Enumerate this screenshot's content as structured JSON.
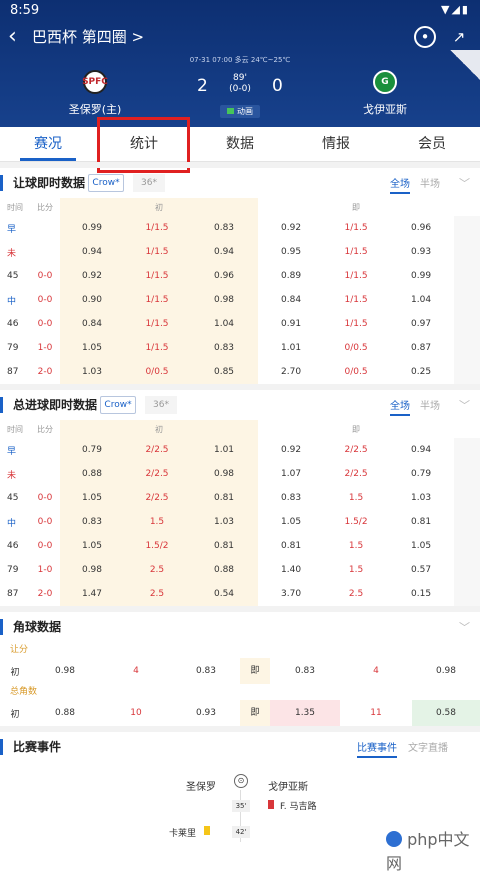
{
  "status": {
    "time": "8:59"
  },
  "nav": {
    "title": "巴西杯 第四圈 >"
  },
  "match": {
    "info": "07-31 07:00  多云 24℃~25℃",
    "home": {
      "name": "圣保罗(主)",
      "logo": "SPFC",
      "score": "2"
    },
    "away": {
      "name": "戈伊亚斯",
      "logo": "G",
      "score": "0"
    },
    "minute": "89'",
    "halftime": "(0-0)",
    "anim_label": "动画"
  },
  "tabs": [
    "赛况",
    "统计",
    "数据",
    "情报",
    "会员"
  ],
  "handicap": {
    "title": "让球即时数据",
    "crow": "Crow*",
    "alt": "36*",
    "seg_on": "全场",
    "seg_off": "半场",
    "header": [
      "时间",
      "比分",
      "初",
      "即"
    ],
    "rows": [
      [
        "早",
        "",
        "0.99",
        "1/1.5",
        "0.83",
        "0.92",
        "1/1.5",
        "0.96"
      ],
      [
        "未",
        "",
        "0.94",
        "1/1.5",
        "0.94",
        "0.95",
        "1/1.5",
        "0.93"
      ],
      [
        "45",
        "0-0",
        "0.92",
        "1/1.5",
        "0.96",
        "0.89",
        "1/1.5",
        "0.99"
      ],
      [
        "中",
        "0-0",
        "0.90",
        "1/1.5",
        "0.98",
        "0.84",
        "1/1.5",
        "1.04"
      ],
      [
        "46",
        "0-0",
        "0.84",
        "1/1.5",
        "1.04",
        "0.91",
        "1/1.5",
        "0.97"
      ],
      [
        "79",
        "1-0",
        "1.05",
        "1/1.5",
        "0.83",
        "1.01",
        "0/0.5",
        "0.87"
      ],
      [
        "87",
        "2-0",
        "1.03",
        "0/0.5",
        "0.85",
        "2.70",
        "0/0.5",
        "0.25"
      ]
    ]
  },
  "totals": {
    "title": "总进球即时数据",
    "crow": "Crow*",
    "alt": "36*",
    "seg_on": "全场",
    "seg_off": "半场",
    "header": [
      "时间",
      "比分",
      "初",
      "即"
    ],
    "rows": [
      [
        "早",
        "",
        "0.79",
        "2/2.5",
        "1.01",
        "0.92",
        "2/2.5",
        "0.94"
      ],
      [
        "未",
        "",
        "0.88",
        "2/2.5",
        "0.98",
        "1.07",
        "2/2.5",
        "0.79"
      ],
      [
        "45",
        "0-0",
        "1.05",
        "2/2.5",
        "0.81",
        "0.83",
        "1.5",
        "1.03"
      ],
      [
        "中",
        "0-0",
        "0.83",
        "1.5",
        "1.03",
        "1.05",
        "1.5/2",
        "0.81"
      ],
      [
        "46",
        "0-0",
        "1.05",
        "1.5/2",
        "0.81",
        "0.81",
        "1.5",
        "1.05"
      ],
      [
        "79",
        "1-0",
        "0.98",
        "2.5",
        "0.88",
        "1.40",
        "1.5",
        "0.57"
      ],
      [
        "87",
        "2-0",
        "1.47",
        "2.5",
        "0.54",
        "3.70",
        "2.5",
        "0.15"
      ]
    ]
  },
  "corners": {
    "title": "角球数据",
    "rows": [
      {
        "label": "让分",
        "init_label": "初",
        "init": [
          "0.98",
          "4",
          "0.83"
        ],
        "live_label": "即",
        "live": [
          "0.83",
          "4",
          "0.98"
        ]
      },
      {
        "label": "总角数",
        "init_label": "初",
        "init": [
          "0.88",
          "10",
          "0.93"
        ],
        "live_label": "即",
        "live": [
          "1.35",
          "11",
          "0.58"
        ]
      }
    ]
  },
  "events": {
    "title": "比赛事件",
    "tab_on": "比赛事件",
    "tab_off": "文字直播",
    "home": "圣保罗",
    "away": "戈伊亚斯",
    "items": [
      {
        "minute": "35'",
        "player": "F. 马吉路",
        "side": "away",
        "card": "red"
      },
      {
        "minute": "42'",
        "player": "卡莱里",
        "side": "home",
        "card": "yellow"
      }
    ]
  },
  "watermark": "php中文网"
}
